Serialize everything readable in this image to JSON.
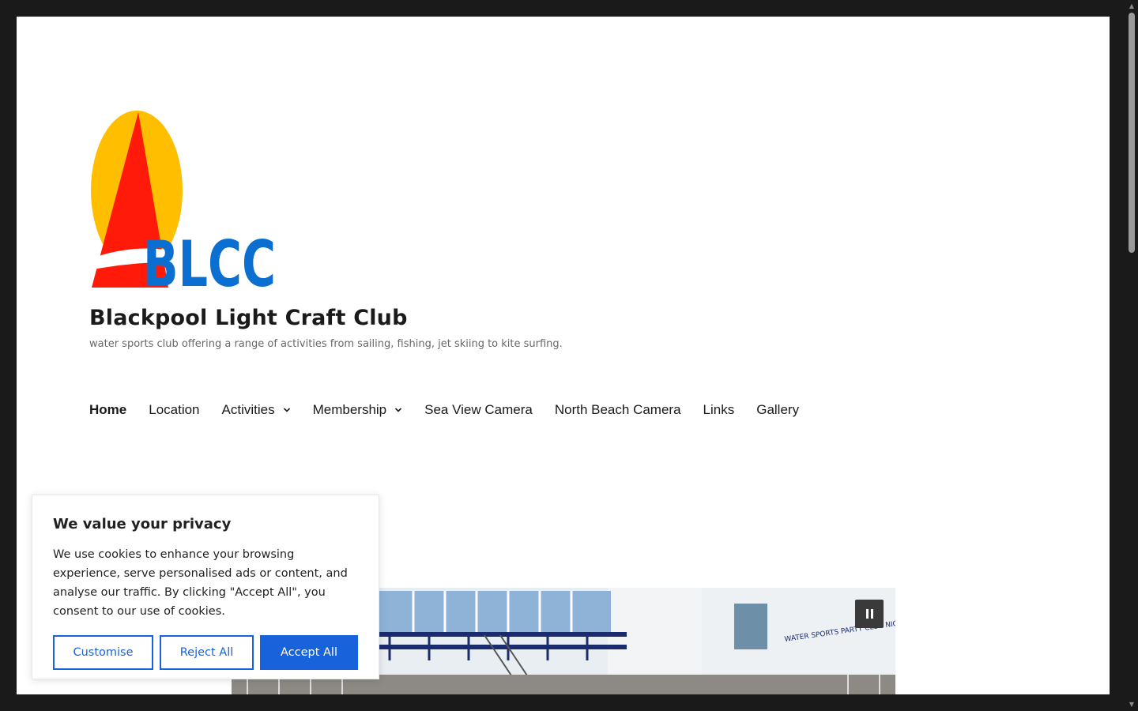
{
  "site": {
    "title": "Blackpool Light Craft Club",
    "tagline": "water sports club offering a range of activities from sailing, fishing, jet skiing to kite surfing.",
    "logo_text": "BLCC",
    "logo_colors": {
      "sail": "#ff1a0a",
      "sun": "#ffbf00",
      "letters": "#0a6fd0"
    }
  },
  "nav": {
    "items": [
      {
        "label": "Home",
        "active": true,
        "dropdown": false
      },
      {
        "label": "Location",
        "active": false,
        "dropdown": false
      },
      {
        "label": "Activities",
        "active": false,
        "dropdown": true
      },
      {
        "label": "Membership",
        "active": false,
        "dropdown": true
      },
      {
        "label": "Sea View Camera",
        "active": false,
        "dropdown": false
      },
      {
        "label": "North Beach Camera",
        "active": false,
        "dropdown": false
      },
      {
        "label": "Links",
        "active": false,
        "dropdown": false
      },
      {
        "label": "Gallery",
        "active": false,
        "dropdown": false
      }
    ]
  },
  "slider": {
    "sign_text": "WATER SPORTS PARTY CLUB NIGHTS WAKEBOARDING KITESURFING JET-SKIING SAILING MEMBERS ONLY",
    "pause_icon": "pause-icon"
  },
  "cookie": {
    "title": "We value your privacy",
    "body": "We use cookies to enhance your browsing experience, serve personalised ads or content, and analyse our traffic. By clicking \"Accept All\", you consent to our use of cookies.",
    "customise_label": "Customise",
    "reject_label": "Reject All",
    "accept_label": "Accept All",
    "accent": "#1863dc"
  }
}
